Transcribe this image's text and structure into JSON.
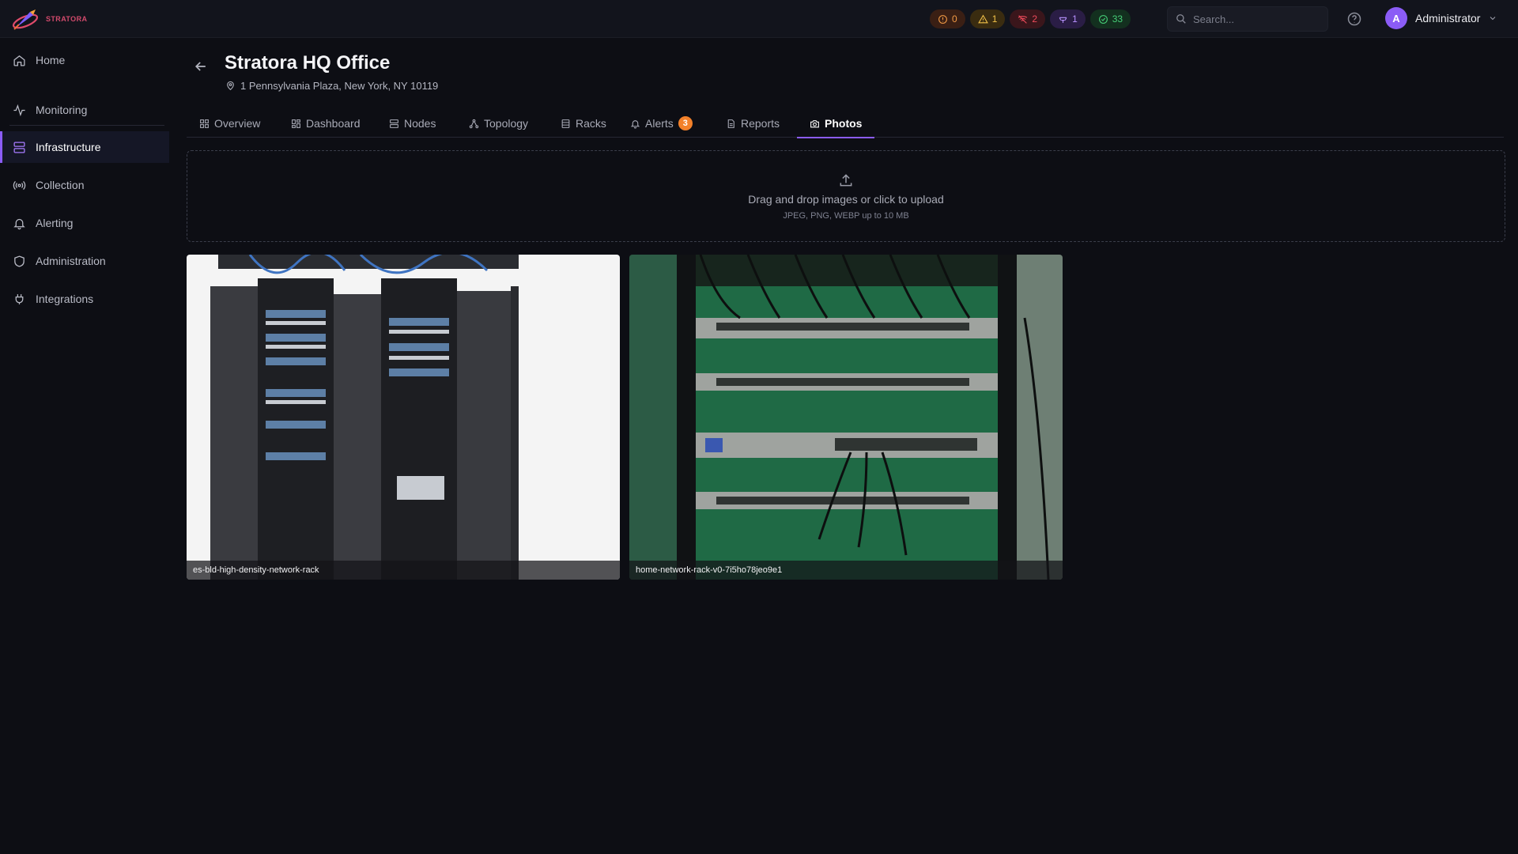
{
  "app": {
    "brand": "STRATORA"
  },
  "status_pills": [
    {
      "type": "critical",
      "icon": "alert-circle-icon",
      "count": "0",
      "color": "#f29a45"
    },
    {
      "type": "warning",
      "icon": "warning-triangle-icon",
      "count": "1",
      "color": "#f1c148"
    },
    {
      "type": "down",
      "icon": "wifi-off-icon",
      "count": "2",
      "color": "#ee4b5b"
    },
    {
      "type": "maintenance",
      "icon": "wrench-icon",
      "count": "1",
      "color": "#b892ff"
    },
    {
      "type": "ok",
      "icon": "check-circle-icon",
      "count": "33",
      "color": "#46cf78"
    }
  ],
  "search": {
    "placeholder": "Search..."
  },
  "user": {
    "initial": "A",
    "name": "Administrator"
  },
  "sidebar": {
    "items": [
      {
        "label": "Home",
        "icon": "home-icon"
      },
      {
        "label": "Monitoring",
        "icon": "activity-icon"
      },
      {
        "label": "Infrastructure",
        "icon": "server-icon",
        "active": true
      },
      {
        "label": "Collection",
        "icon": "radio-icon"
      },
      {
        "label": "Alerting",
        "icon": "bell-icon"
      },
      {
        "label": "Administration",
        "icon": "shield-icon"
      },
      {
        "label": "Integrations",
        "icon": "plug-icon"
      }
    ]
  },
  "site": {
    "title": "Stratora HQ Office",
    "address": "1 Pennsylvania Plaza, New York, NY 10119"
  },
  "tabs": [
    {
      "label": "Overview",
      "icon": "grid-icon"
    },
    {
      "label": "Dashboard",
      "icon": "dashboard-icon"
    },
    {
      "label": "Nodes",
      "icon": "server-icon"
    },
    {
      "label": "Topology",
      "icon": "topology-icon"
    },
    {
      "label": "Racks",
      "icon": "rack-icon"
    },
    {
      "label": "Alerts",
      "icon": "bell-icon",
      "badge": "3"
    },
    {
      "label": "Reports",
      "icon": "file-icon"
    },
    {
      "label": "Photos",
      "icon": "camera-icon",
      "active": true
    }
  ],
  "upload": {
    "main": "Drag and drop images or click to upload",
    "sub": "JPEG, PNG, WEBP up to 10 MB"
  },
  "photos": [
    {
      "caption": "es-bld-high-density-network-rack"
    },
    {
      "caption": "home-network-rack-v0-7i5ho78jeo9e1"
    }
  ],
  "colors": {
    "accent": "#8b5cf6",
    "background": "#0d0e14",
    "badge": "#f3812a"
  }
}
